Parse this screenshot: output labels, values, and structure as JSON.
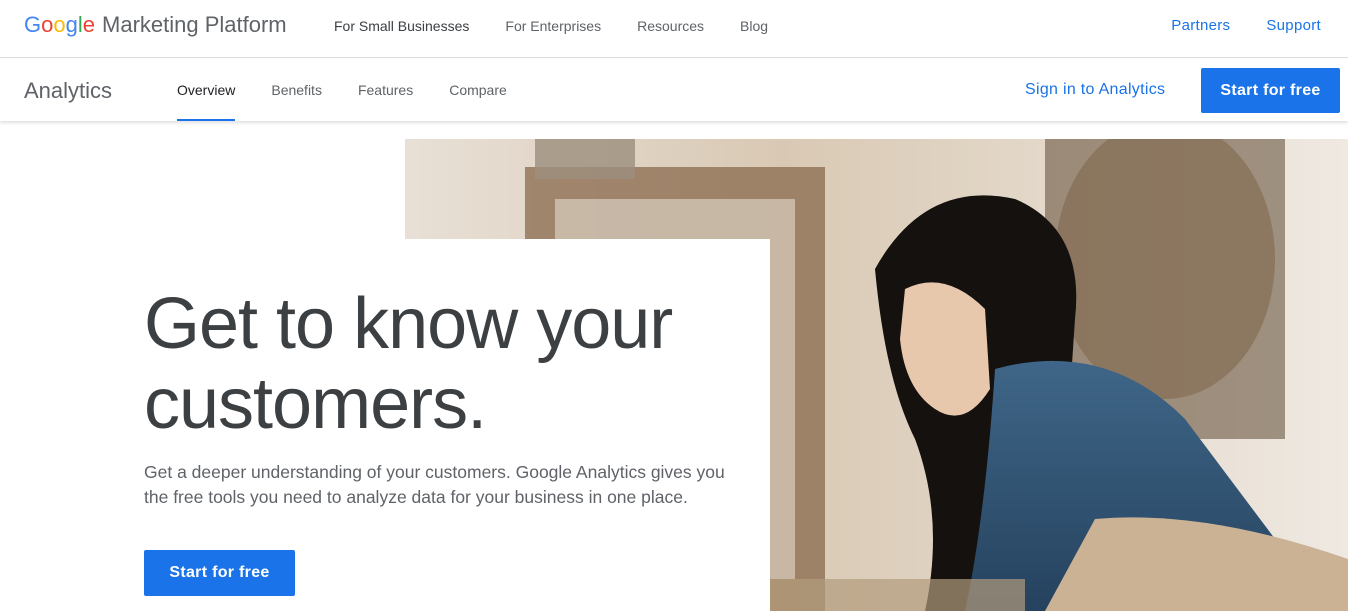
{
  "brand": {
    "logo_letters": [
      {
        "char": "G",
        "color": "#4285f4"
      },
      {
        "char": "o",
        "color": "#ea4335"
      },
      {
        "char": "o",
        "color": "#fbbc05"
      },
      {
        "char": "g",
        "color": "#4285f4"
      },
      {
        "char": "l",
        "color": "#34a853"
      },
      {
        "char": "e",
        "color": "#ea4335"
      }
    ],
    "platform_name": "Marketing Platform"
  },
  "top_nav": {
    "items": [
      "For Small Businesses",
      "For Enterprises",
      "Resources",
      "Blog"
    ],
    "right_links": [
      "Partners",
      "Support"
    ]
  },
  "sub_nav": {
    "product_name": "Analytics",
    "tabs": [
      {
        "label": "Overview",
        "active": true
      },
      {
        "label": "Benefits",
        "active": false
      },
      {
        "label": "Features",
        "active": false
      },
      {
        "label": "Compare",
        "active": false
      }
    ],
    "sign_in_label": "Sign in to Analytics",
    "cta_label": "Start for free"
  },
  "hero": {
    "headline_line1": "Get to know your",
    "headline_line2": "customers.",
    "description": "Get a deeper understanding of your customers. Google Analytics gives you the free tools you need to analyze data for your business in one place.",
    "cta_label": "Start for free",
    "image_alt": "woman-in-denim-shirt-in-shop"
  },
  "colors": {
    "accent": "#1a73e8",
    "text_dark": "#3c4043",
    "text_muted": "#5f6368"
  }
}
